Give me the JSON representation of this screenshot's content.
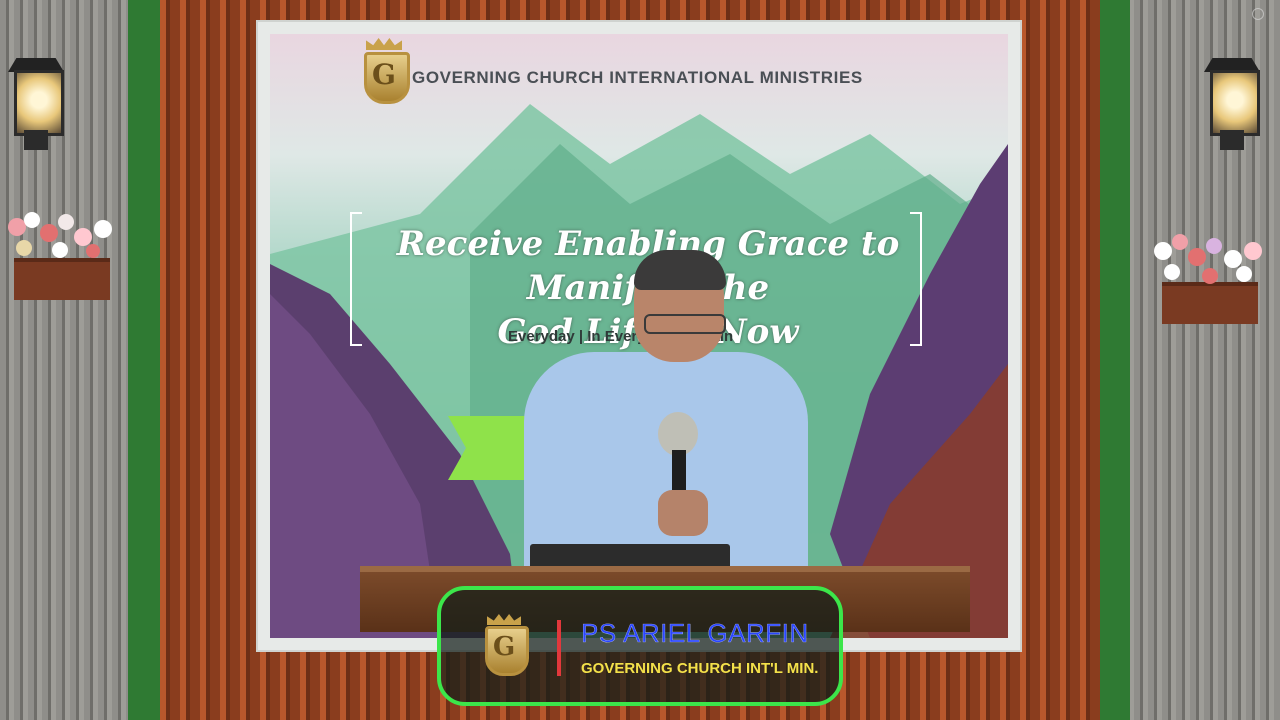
{
  "banner": {
    "organization": "GOVERNING CHURCH INTERNATIONAL MINISTRIES",
    "theme_line1": "Receive Enabling Grace to Manifest the",
    "theme_line2": "God Life … Now",
    "theme_sub": "Everyday | In Every W… …main"
  },
  "lower_third": {
    "name": "PS ARIEL GARFIN",
    "organization": "GOVERNING CHURCH INT'L MIN."
  },
  "colors": {
    "lower_third_border": "#3ce64a",
    "name_text": "#2a46ff",
    "org_text": "#f4e14a",
    "divider": "#e2383c"
  },
  "icons": [
    "church-logo-icon",
    "wall-lamp-icon",
    "flower-planter-icon"
  ]
}
